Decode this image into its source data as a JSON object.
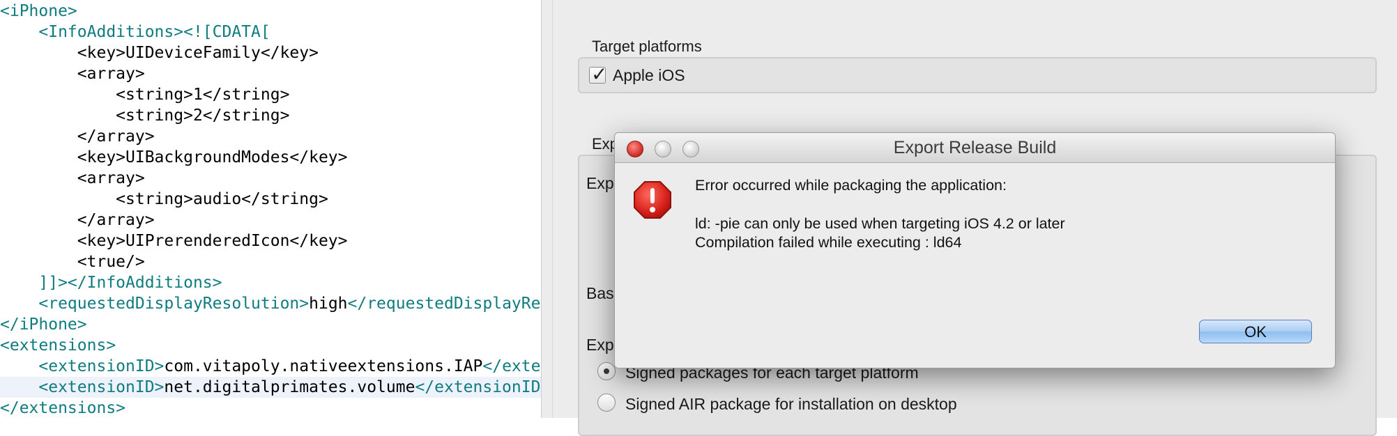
{
  "editor": {
    "lines": [
      [
        {
          "c": "tag",
          "t": "<iPhone>"
        }
      ],
      [
        {
          "c": "txt",
          "t": "    "
        },
        {
          "c": "tag",
          "t": "<InfoAdditions><![CDATA["
        }
      ],
      [
        {
          "c": "txt",
          "t": "        <key>UIDeviceFamily</key>"
        }
      ],
      [
        {
          "c": "txt",
          "t": "        <array>"
        }
      ],
      [
        {
          "c": "txt",
          "t": "            <string>1</string>"
        }
      ],
      [
        {
          "c": "txt",
          "t": "            <string>2</string>"
        }
      ],
      [
        {
          "c": "txt",
          "t": "        </array>"
        }
      ],
      [
        {
          "c": "txt",
          "t": "        <key>UIBackgroundModes</key>"
        }
      ],
      [
        {
          "c": "txt",
          "t": "        <array>"
        }
      ],
      [
        {
          "c": "txt",
          "t": "            <string>audio</string>"
        }
      ],
      [
        {
          "c": "txt",
          "t": "        </array>"
        }
      ],
      [
        {
          "c": "txt",
          "t": "        <key>UIPrerenderedIcon</key>"
        }
      ],
      [
        {
          "c": "txt",
          "t": "        <true/>"
        }
      ],
      [
        {
          "c": "txt",
          "t": "    "
        },
        {
          "c": "tag",
          "t": "]]></InfoAdditions>"
        }
      ],
      [
        {
          "c": "txt",
          "t": "    "
        },
        {
          "c": "tag",
          "t": "<requestedDisplayResolution>"
        },
        {
          "c": "txt",
          "t": "high"
        },
        {
          "c": "tag",
          "t": "</requestedDisplayRe"
        }
      ],
      [
        {
          "c": "tag",
          "t": "</iPhone>"
        }
      ],
      [
        {
          "c": "tag",
          "t": "<extensions>"
        }
      ],
      [
        {
          "c": "txt",
          "t": "    "
        },
        {
          "c": "tag",
          "t": "<extensionID>"
        },
        {
          "c": "txt",
          "t": "com.vitapoly.nativeextensions.IAP"
        },
        {
          "c": "tag",
          "t": "</exte"
        }
      ],
      [
        {
          "c": "txt",
          "t": "    "
        },
        {
          "c": "tag",
          "t": "<extensionID>"
        },
        {
          "c": "txt",
          "t": "net.digitalprimates.volume"
        },
        {
          "c": "tag",
          "t": "</extensionID"
        }
      ],
      [
        {
          "c": "tag",
          "t": "</extensions>"
        }
      ]
    ],
    "highlighted_line": 18
  },
  "panel": {
    "target_platforms_label": "Target platforms",
    "apple_ios_label": "Apple iOS",
    "apple_ios_checked": true,
    "export_group_label_partial": "Exp",
    "export_field_label_partial": "Expo",
    "base_label_partial": "Base",
    "export_as_label_partial": "Expo",
    "option_signed_packages": "Signed packages for each target platform",
    "option_signed_air": "Signed AIR package for installation on desktop",
    "selected_option": "signed_packages"
  },
  "dialog": {
    "title": "Export Release Build",
    "message_heading": "Error occurred while packaging the application:",
    "message_line1": "ld: -pie can only be used when targeting iOS 4.2 or later",
    "message_line2": "Compilation failed while executing : ld64",
    "ok_label": "OK"
  },
  "colors": {
    "code_tag": "#0f7c80",
    "code_text": "#000000",
    "alert_red": "#d8211a",
    "ok_button_blue": "#a9cdf3"
  },
  "icons": [
    "checkmark-icon",
    "alert-octagon-icon",
    "close-window-icon",
    "minimize-window-icon",
    "zoom-window-icon"
  ]
}
